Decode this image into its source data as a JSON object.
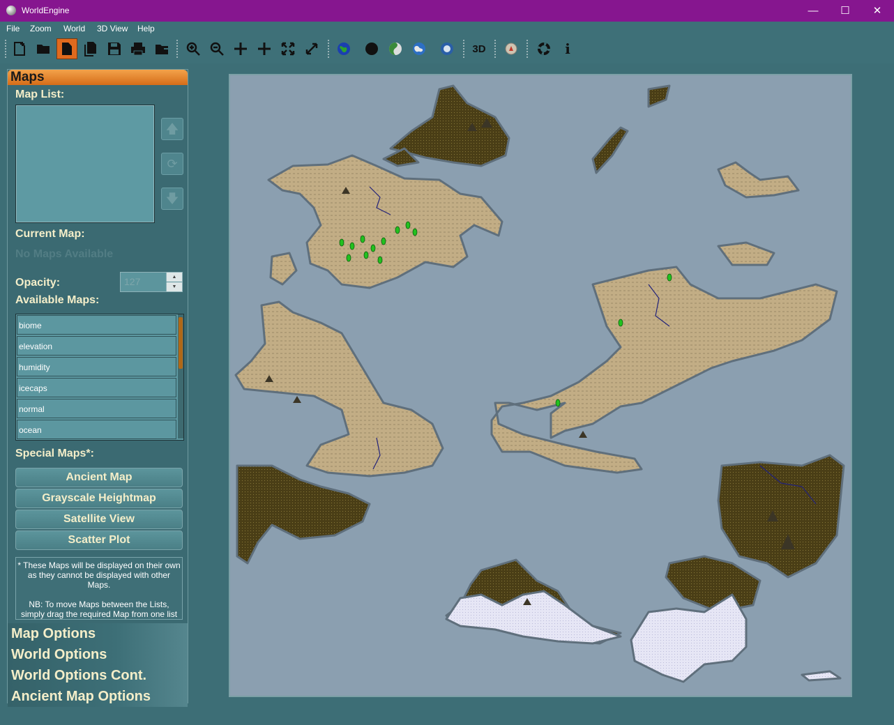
{
  "window": {
    "title": "WorldEngine",
    "minimize": "—",
    "maximize": "☐",
    "close": "✕"
  },
  "menu": {
    "items": [
      "File",
      "Zoom",
      "World",
      "3D View",
      "Help"
    ]
  },
  "toolbar": {
    "buttons": [
      "new-document-icon",
      "open-folder-icon",
      "file-icon",
      "copy-icon",
      "save-icon",
      "print-icon",
      "export-folder-icon",
      "zoom-in-icon",
      "zoom-out-icon",
      "pan-icon",
      "crosshair-icon",
      "fit-view-icon",
      "expand-icon",
      "globe-icon",
      "dark-globe-icon",
      "shaded-globe-icon",
      "earth-icon",
      "satellite-icon",
      "3d-view-icon",
      "compass-icon",
      "help-lifebuoy-icon",
      "info-icon"
    ],
    "three_d_label": "3D",
    "info_label": "i"
  },
  "sidebar": {
    "header": "Maps",
    "map_list_label": "Map List:",
    "current_map_label": "Current Map:",
    "current_map_value": "No Maps Available",
    "opacity_label": "Opacity:",
    "opacity_value": "127",
    "available_maps_label": "Available Maps:",
    "available_maps": [
      "biome",
      "elevation",
      "humidity",
      "icecaps",
      "normal",
      "ocean"
    ],
    "special_maps_label": "Special Maps*:",
    "special_maps": [
      "Ancient Map",
      "Grayscale Heightmap",
      "Satellite View",
      "Scatter Plot"
    ],
    "note_line1": "* These Maps will be displayed on their own as they cannot be displayed with other Maps.",
    "note_line2": "NB: To move Maps between the Lists, simply drag the required Map from one list",
    "sections": [
      "Map Options",
      "World Options",
      "World Options Cont.",
      "Ancient Map Options"
    ]
  },
  "colors": {
    "titlebar": "#86168f",
    "background": "#3d6e76",
    "accent": "#e06a1e",
    "sea": "#8b9fb0",
    "land": "#c2ad85",
    "forest": "#4a3e16",
    "ice": "#e6e6f5",
    "label_text": "#f4eec9"
  }
}
